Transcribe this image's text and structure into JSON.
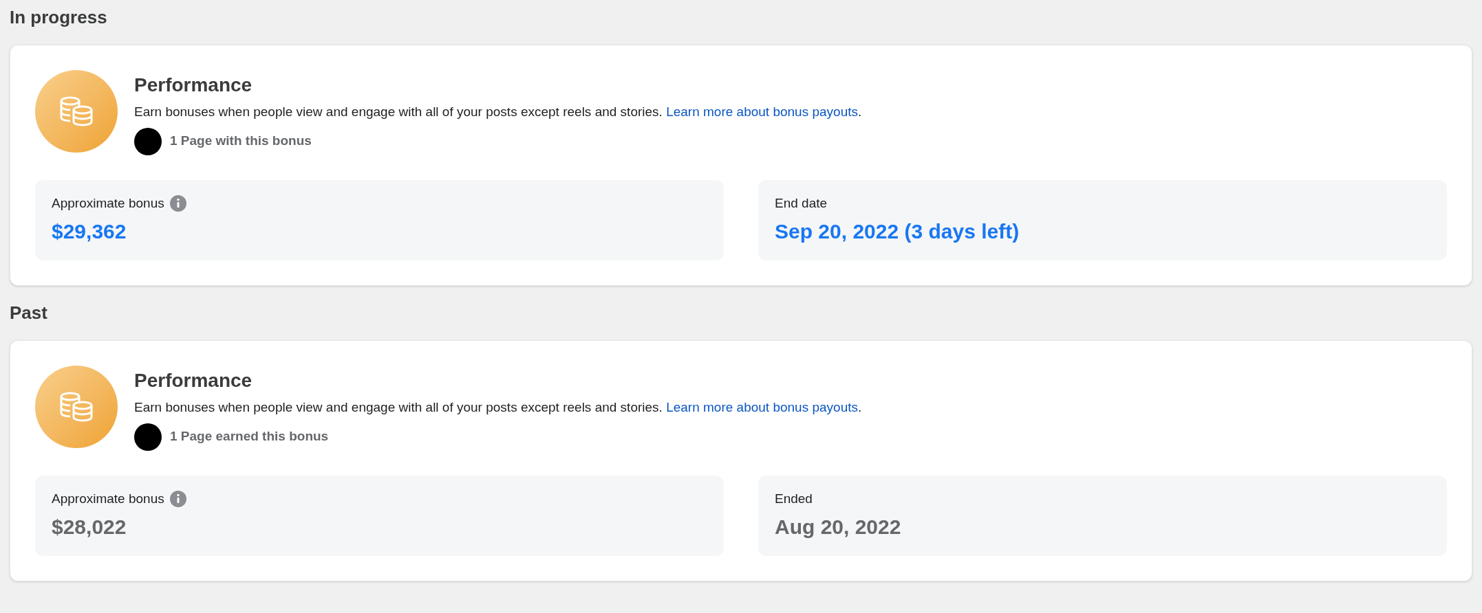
{
  "sections": [
    {
      "heading": "In progress",
      "card": {
        "title": "Performance",
        "description": "Earn bonuses when people view and engage with all of your posts except reels and stories.",
        "link": "Learn more about bonus payouts",
        "after_link": ".",
        "pages": "1 Page with this bonus",
        "active": true,
        "stats": [
          {
            "label": "Approximate bonus",
            "info": true,
            "value": "$29,362"
          },
          {
            "label": "End date",
            "info": false,
            "value": "Sep 20, 2022 (3 days left)"
          }
        ]
      }
    },
    {
      "heading": "Past",
      "card": {
        "title": "Performance",
        "description": "Earn bonuses when people view and engage with all of your posts except reels and stories.",
        "link": "Learn more about bonus payouts",
        "after_link": ".",
        "pages": "1 Page earned this bonus",
        "active": false,
        "stats": [
          {
            "label": "Approximate bonus",
            "info": true,
            "value": "$28,022"
          },
          {
            "label": "Ended",
            "info": false,
            "value": "Aug 20, 2022"
          }
        ]
      }
    }
  ]
}
